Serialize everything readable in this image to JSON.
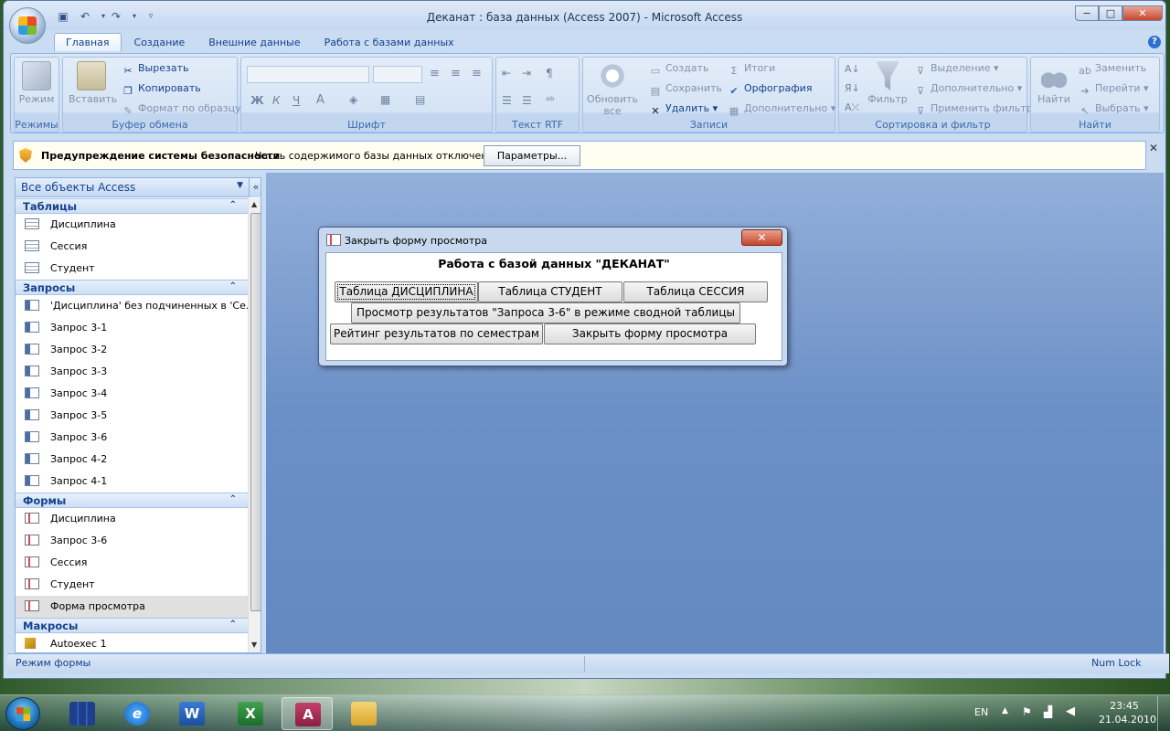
{
  "window": {
    "title": "Деканат : база данных (Access 2007) - Microsoft Access",
    "minimize": "−",
    "maximize": "□",
    "close": "✕"
  },
  "tabs": [
    "Главная",
    "Создание",
    "Внешние данные",
    "Работа с базами данных"
  ],
  "ribbon": {
    "modes": {
      "label": "Режимы",
      "button": "Режим"
    },
    "clipboard": {
      "label": "Буфер обмена",
      "paste": "Вставить",
      "cut": "Вырезать",
      "copy": "Копировать",
      "format_painter": "Формат по образцу"
    },
    "font": {
      "label": "Шрифт",
      "bold": "Ж",
      "italic": "К",
      "underline": "Ч",
      "color_a": "A"
    },
    "rtf": {
      "label": "Текст RTF"
    },
    "records": {
      "label": "Записи",
      "refresh_line1": "Обновить",
      "refresh_line2": "все",
      "create": "Создать",
      "save": "Сохранить",
      "delete": "Удалить",
      "totals": "Итоги",
      "spelling": "Орфография",
      "more": "Дополнительно"
    },
    "sort": {
      "label": "Сортировка и фильтр",
      "filter": "Фильтр",
      "selection": "Выделение",
      "advanced": "Дополнительно",
      "apply_filter": "Применить фильтр"
    },
    "find": {
      "label": "Найти",
      "find": "Найти",
      "replace": "Заменить",
      "goto": "Перейти",
      "select": "Выбрать"
    }
  },
  "security": {
    "title": "Предупреждение системы безопасности",
    "message": "Часть содержимого базы данных отключено",
    "button": "Параметры...",
    "close": "✕"
  },
  "nav": {
    "header": "Все объекты Access",
    "sections": [
      {
        "title": "Таблицы",
        "kind": "tbl",
        "items": [
          "Дисциплина",
          "Сессия",
          "Студент"
        ]
      },
      {
        "title": "Запросы",
        "kind": "qry",
        "items": [
          "'Дисциплина' без подчиненных в 'Се...",
          "Запрос 3-1",
          "Запрос 3-2",
          "Запрос 3-3",
          "Запрос 3-4",
          "Запрос 3-5",
          "Запрос 3-6",
          "Запрос 4-2",
          "Запрос 4-1"
        ]
      },
      {
        "title": "Формы",
        "kind": "frm",
        "items": [
          "Дисциплина",
          "Запрос 3-6",
          "Сессия",
          "Студент",
          "Форма просмотра"
        ]
      },
      {
        "title": "Макросы",
        "kind": "mac",
        "items": [
          "Autoexec 1"
        ]
      }
    ],
    "selected_item": "Форма просмотра"
  },
  "dialog": {
    "title": "Закрыть форму просмотра",
    "heading": "Работа с базой данных \"ДЕКАНАТ\"",
    "buttons": {
      "table_discipline": "Таблица ДИСЦИПЛИНА",
      "table_student": "Таблица СТУДЕНТ",
      "table_session": "Таблица СЕССИЯ",
      "pivot_view": "Просмотр результатов \"Запроса  3-6\" в режиме сводной таблицы",
      "rating": "Рейтинг результатов по семестрам",
      "close_form": "Закрыть форму просмотра"
    }
  },
  "status": {
    "left": "Режим формы",
    "right": "Num Lock"
  },
  "taskbar": {
    "lang": "EN",
    "time": "23:45",
    "date": "21.04.2010"
  }
}
